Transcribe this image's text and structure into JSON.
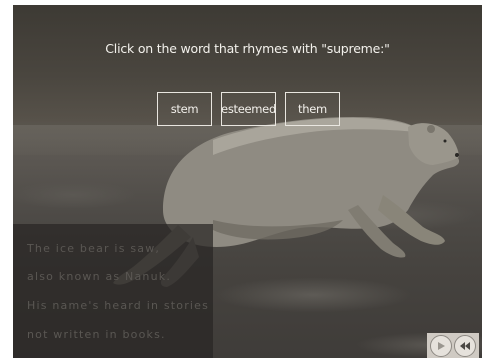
{
  "question": {
    "prompt": "Click on the word that rhymes with \"supreme:\""
  },
  "choices": [
    {
      "label": "stem"
    },
    {
      "label": "esteemed"
    },
    {
      "label": "them"
    }
  ],
  "poem": {
    "lines": [
      "The ice bear is saw,",
      "also known as Nanuk.",
      "His name's heard in stories",
      "not written in books."
    ]
  },
  "controls": {
    "play_icon": "play-icon",
    "rewind_icon": "rewind-icon"
  }
}
